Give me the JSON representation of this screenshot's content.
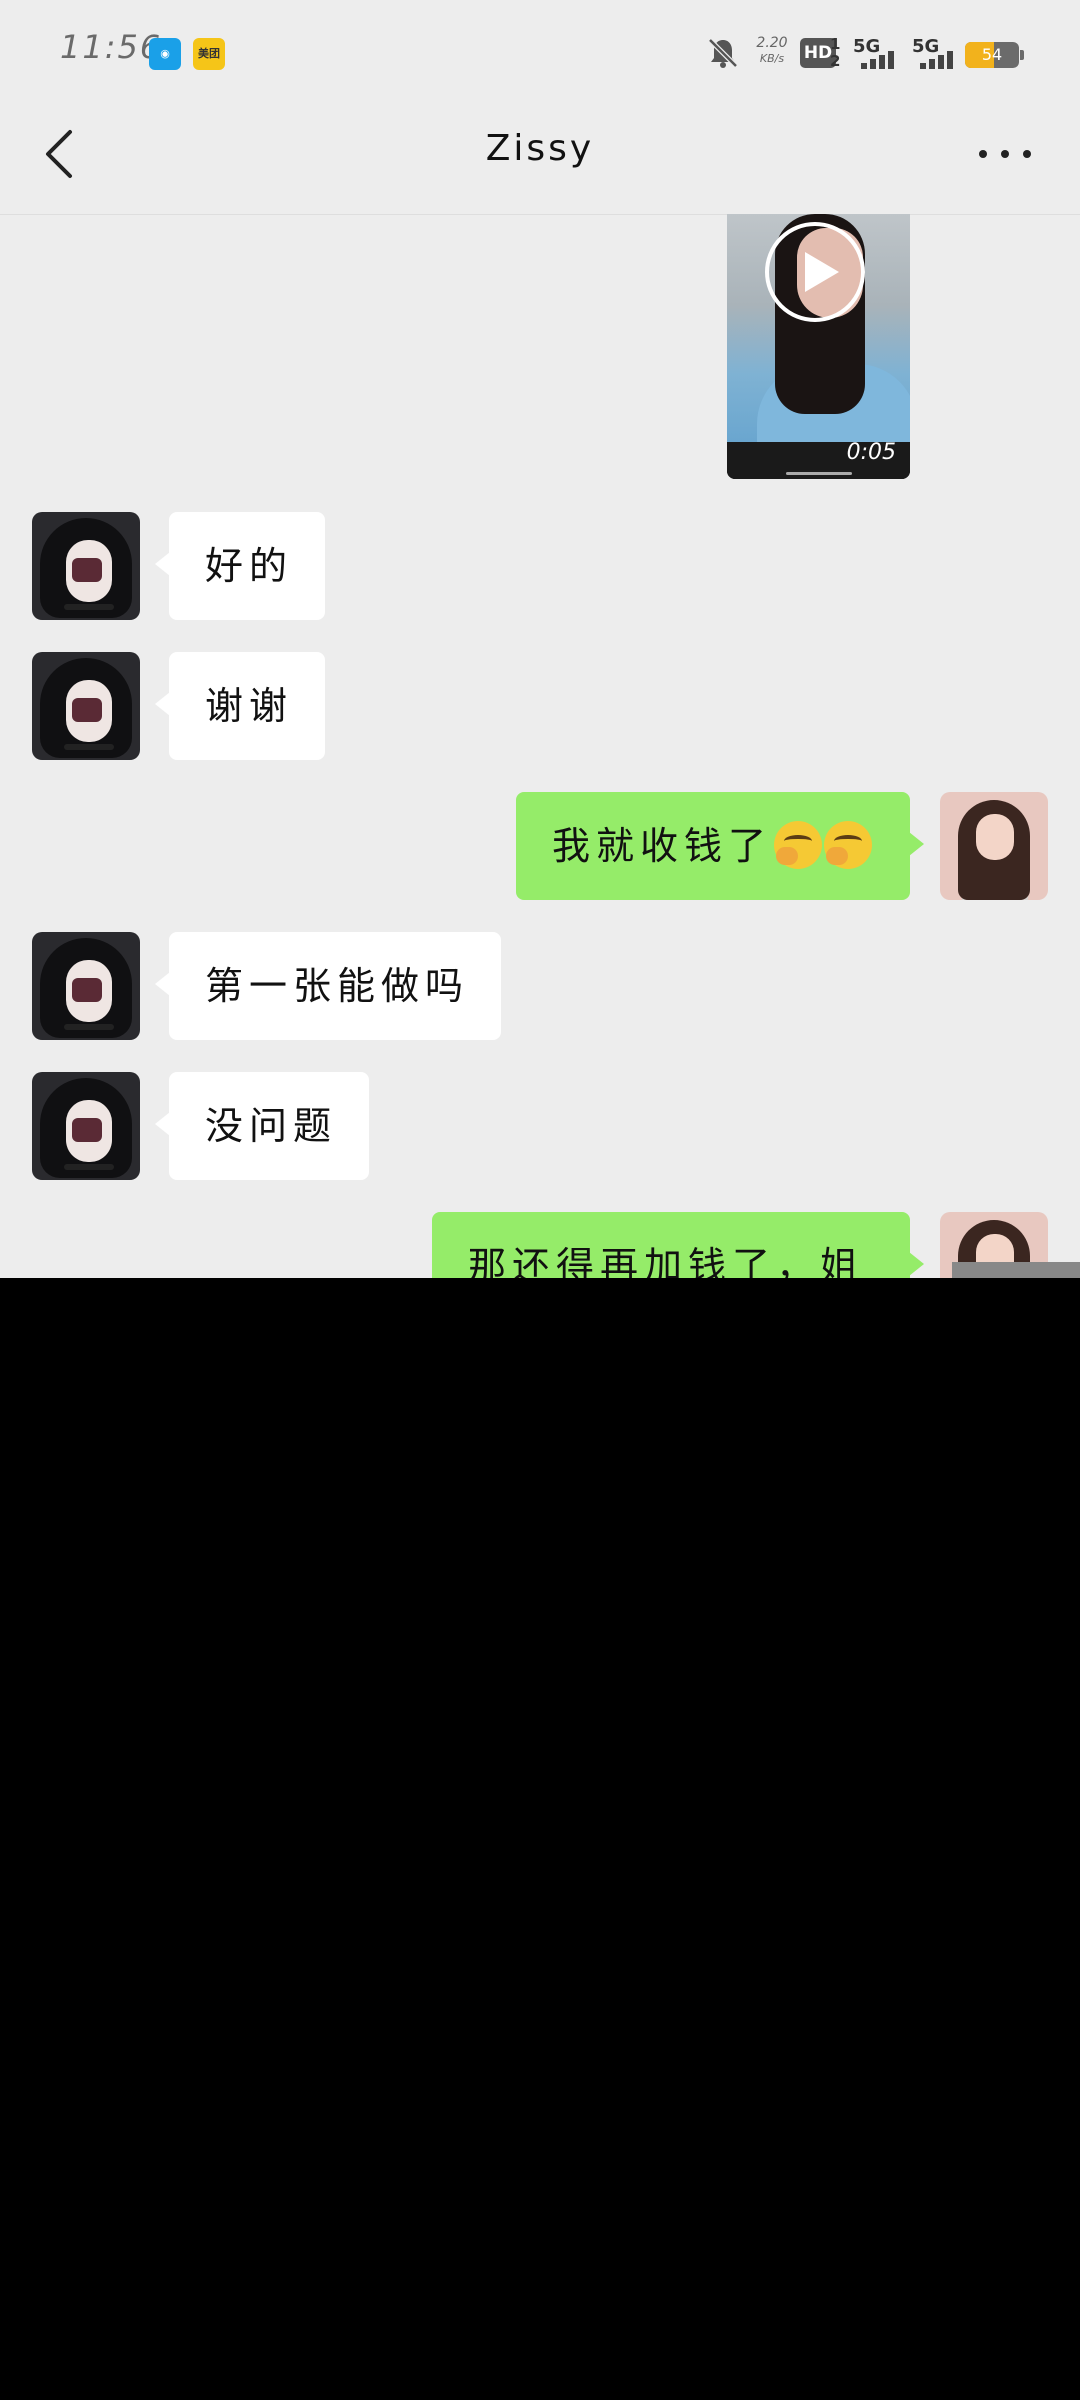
{
  "status_bar": {
    "time": "11:56",
    "app_icons": [
      "qq-icon",
      "meituan-icon"
    ],
    "meituan_label": "美团",
    "net_speed_value": "2.20",
    "net_speed_unit": "KB/s",
    "hd_label": "HD",
    "hd_sim": "1\n2",
    "signal1_label": "5G",
    "signal2_label": "5G",
    "battery_level": "54"
  },
  "nav": {
    "title": "Zissy"
  },
  "messages": [
    {
      "from": "me",
      "type": "video",
      "duration": "0:05"
    },
    {
      "from": "other",
      "type": "text",
      "text": "好的"
    },
    {
      "from": "other",
      "type": "text",
      "text": "谢谢"
    },
    {
      "from": "me",
      "type": "text",
      "text": "我就收钱了",
      "emoji": [
        "face-with-hand-over-mouth",
        "face-with-hand-over-mouth"
      ]
    },
    {
      "from": "other",
      "type": "text",
      "text": "第一张能做吗"
    },
    {
      "from": "other",
      "type": "text",
      "text": "没问题"
    },
    {
      "from": "me",
      "type": "text",
      "text": "那还得再加钱了，姐"
    }
  ],
  "colors": {
    "chat_background": "#ededed",
    "outgoing_bubble": "#95ec69",
    "incoming_bubble": "#ffffff",
    "battery_fill": "#f2b21c"
  }
}
